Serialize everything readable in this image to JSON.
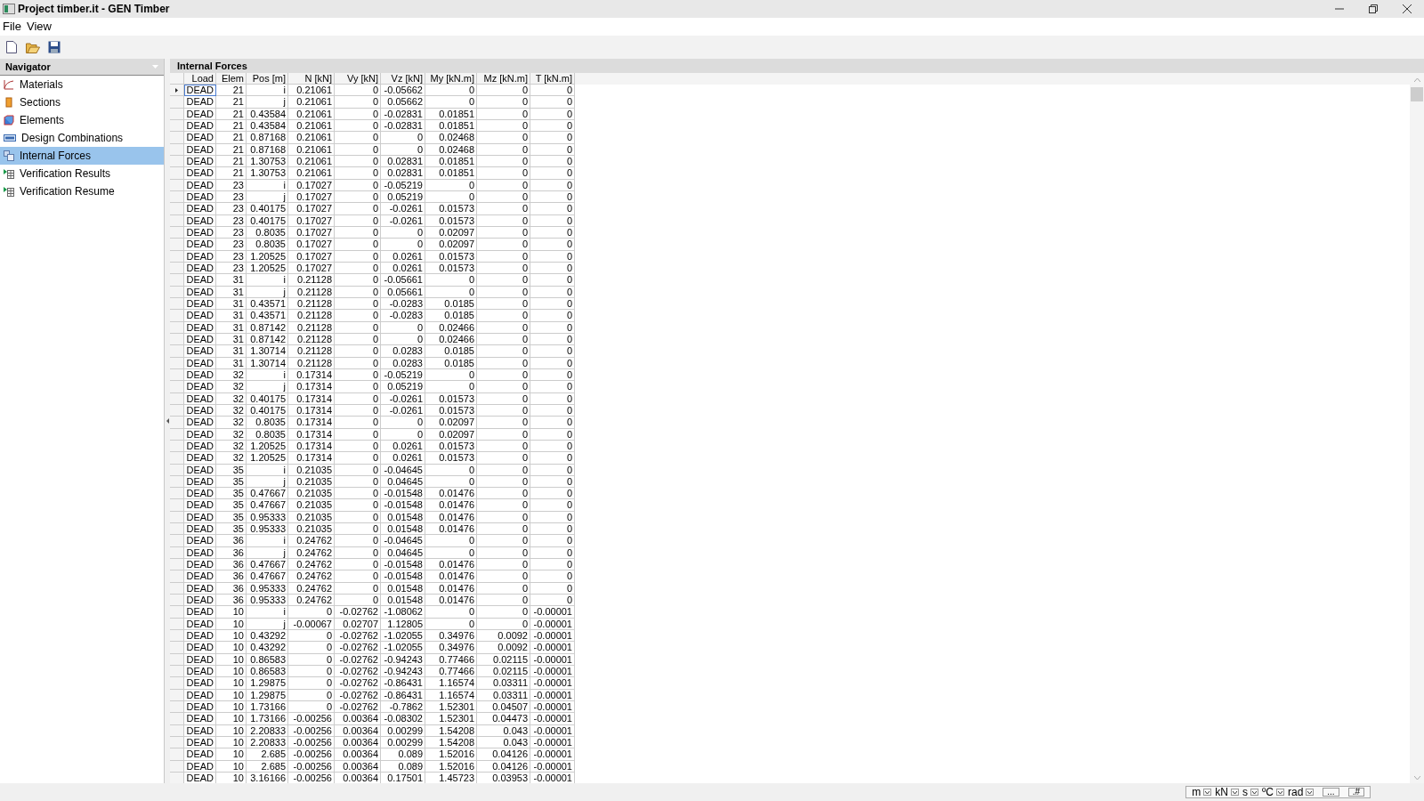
{
  "window": {
    "title": "Project timber.it - GEN Timber"
  },
  "menu": [
    "File",
    "View"
  ],
  "navigator": {
    "title": "Navigator",
    "items": [
      {
        "label": "Materials",
        "kind": "materials",
        "selected": false
      },
      {
        "label": "Sections",
        "kind": "sections",
        "selected": false
      },
      {
        "label": "Elements",
        "kind": "elements",
        "selected": false
      },
      {
        "label": "Design Combinations",
        "kind": "combinations",
        "selected": false
      },
      {
        "label": "Internal Forces",
        "kind": "forces",
        "selected": true
      },
      {
        "label": "Verification Results",
        "kind": "results",
        "selected": false
      },
      {
        "label": "Verification Resume",
        "kind": "results",
        "selected": false
      }
    ]
  },
  "panel": {
    "title": "Internal Forces"
  },
  "table": {
    "columns": [
      "Load",
      "Elem",
      "Pos [m]",
      "N [kN]",
      "Vy [kN]",
      "Vz [kN]",
      "My [kN.m]",
      "Mz [kN.m]",
      "T [kN.m]"
    ],
    "rows": [
      {
        "selected": true,
        "cells": [
          "DEAD",
          "21",
          "i",
          "0.21061",
          "0",
          "-0.05662",
          "0",
          "0",
          "0"
        ]
      },
      {
        "selected": false,
        "cells": [
          "DEAD",
          "21",
          "j",
          "0.21061",
          "0",
          "0.05662",
          "0",
          "0",
          "0"
        ]
      },
      {
        "selected": false,
        "cells": [
          "DEAD",
          "21",
          "0.43584",
          "0.21061",
          "0",
          "-0.02831",
          "0.01851",
          "0",
          "0"
        ]
      },
      {
        "selected": false,
        "cells": [
          "DEAD",
          "21",
          "0.43584",
          "0.21061",
          "0",
          "-0.02831",
          "0.01851",
          "0",
          "0"
        ]
      },
      {
        "selected": false,
        "cells": [
          "DEAD",
          "21",
          "0.87168",
          "0.21061",
          "0",
          "0",
          "0.02468",
          "0",
          "0"
        ]
      },
      {
        "selected": false,
        "cells": [
          "DEAD",
          "21",
          "0.87168",
          "0.21061",
          "0",
          "0",
          "0.02468",
          "0",
          "0"
        ]
      },
      {
        "selected": false,
        "cells": [
          "DEAD",
          "21",
          "1.30753",
          "0.21061",
          "0",
          "0.02831",
          "0.01851",
          "0",
          "0"
        ]
      },
      {
        "selected": false,
        "cells": [
          "DEAD",
          "21",
          "1.30753",
          "0.21061",
          "0",
          "0.02831",
          "0.01851",
          "0",
          "0"
        ]
      },
      {
        "selected": false,
        "cells": [
          "DEAD",
          "23",
          "i",
          "0.17027",
          "0",
          "-0.05219",
          "0",
          "0",
          "0"
        ]
      },
      {
        "selected": false,
        "cells": [
          "DEAD",
          "23",
          "j",
          "0.17027",
          "0",
          "0.05219",
          "0",
          "0",
          "0"
        ]
      },
      {
        "selected": false,
        "cells": [
          "DEAD",
          "23",
          "0.40175",
          "0.17027",
          "0",
          "-0.0261",
          "0.01573",
          "0",
          "0"
        ]
      },
      {
        "selected": false,
        "cells": [
          "DEAD",
          "23",
          "0.40175",
          "0.17027",
          "0",
          "-0.0261",
          "0.01573",
          "0",
          "0"
        ]
      },
      {
        "selected": false,
        "cells": [
          "DEAD",
          "23",
          "0.8035",
          "0.17027",
          "0",
          "0",
          "0.02097",
          "0",
          "0"
        ]
      },
      {
        "selected": false,
        "cells": [
          "DEAD",
          "23",
          "0.8035",
          "0.17027",
          "0",
          "0",
          "0.02097",
          "0",
          "0"
        ]
      },
      {
        "selected": false,
        "cells": [
          "DEAD",
          "23",
          "1.20525",
          "0.17027",
          "0",
          "0.0261",
          "0.01573",
          "0",
          "0"
        ]
      },
      {
        "selected": false,
        "cells": [
          "DEAD",
          "23",
          "1.20525",
          "0.17027",
          "0",
          "0.0261",
          "0.01573",
          "0",
          "0"
        ]
      },
      {
        "selected": false,
        "cells": [
          "DEAD",
          "31",
          "i",
          "0.21128",
          "0",
          "-0.05661",
          "0",
          "0",
          "0"
        ]
      },
      {
        "selected": false,
        "cells": [
          "DEAD",
          "31",
          "j",
          "0.21128",
          "0",
          "0.05661",
          "0",
          "0",
          "0"
        ]
      },
      {
        "selected": false,
        "cells": [
          "DEAD",
          "31",
          "0.43571",
          "0.21128",
          "0",
          "-0.0283",
          "0.0185",
          "0",
          "0"
        ]
      },
      {
        "selected": false,
        "cells": [
          "DEAD",
          "31",
          "0.43571",
          "0.21128",
          "0",
          "-0.0283",
          "0.0185",
          "0",
          "0"
        ]
      },
      {
        "selected": false,
        "cells": [
          "DEAD",
          "31",
          "0.87142",
          "0.21128",
          "0",
          "0",
          "0.02466",
          "0",
          "0"
        ]
      },
      {
        "selected": false,
        "cells": [
          "DEAD",
          "31",
          "0.87142",
          "0.21128",
          "0",
          "0",
          "0.02466",
          "0",
          "0"
        ]
      },
      {
        "selected": false,
        "cells": [
          "DEAD",
          "31",
          "1.30714",
          "0.21128",
          "0",
          "0.0283",
          "0.0185",
          "0",
          "0"
        ]
      },
      {
        "selected": false,
        "cells": [
          "DEAD",
          "31",
          "1.30714",
          "0.21128",
          "0",
          "0.0283",
          "0.0185",
          "0",
          "0"
        ]
      },
      {
        "selected": false,
        "cells": [
          "DEAD",
          "32",
          "i",
          "0.17314",
          "0",
          "-0.05219",
          "0",
          "0",
          "0"
        ]
      },
      {
        "selected": false,
        "cells": [
          "DEAD",
          "32",
          "j",
          "0.17314",
          "0",
          "0.05219",
          "0",
          "0",
          "0"
        ]
      },
      {
        "selected": false,
        "cells": [
          "DEAD",
          "32",
          "0.40175",
          "0.17314",
          "0",
          "-0.0261",
          "0.01573",
          "0",
          "0"
        ]
      },
      {
        "selected": false,
        "cells": [
          "DEAD",
          "32",
          "0.40175",
          "0.17314",
          "0",
          "-0.0261",
          "0.01573",
          "0",
          "0"
        ]
      },
      {
        "selected": false,
        "cells": [
          "DEAD",
          "32",
          "0.8035",
          "0.17314",
          "0",
          "0",
          "0.02097",
          "0",
          "0"
        ]
      },
      {
        "selected": false,
        "cells": [
          "DEAD",
          "32",
          "0.8035",
          "0.17314",
          "0",
          "0",
          "0.02097",
          "0",
          "0"
        ]
      },
      {
        "selected": false,
        "cells": [
          "DEAD",
          "32",
          "1.20525",
          "0.17314",
          "0",
          "0.0261",
          "0.01573",
          "0",
          "0"
        ]
      },
      {
        "selected": false,
        "cells": [
          "DEAD",
          "32",
          "1.20525",
          "0.17314",
          "0",
          "0.0261",
          "0.01573",
          "0",
          "0"
        ]
      },
      {
        "selected": false,
        "cells": [
          "DEAD",
          "35",
          "i",
          "0.21035",
          "0",
          "-0.04645",
          "0",
          "0",
          "0"
        ]
      },
      {
        "selected": false,
        "cells": [
          "DEAD",
          "35",
          "j",
          "0.21035",
          "0",
          "0.04645",
          "0",
          "0",
          "0"
        ]
      },
      {
        "selected": false,
        "cells": [
          "DEAD",
          "35",
          "0.47667",
          "0.21035",
          "0",
          "-0.01548",
          "0.01476",
          "0",
          "0"
        ]
      },
      {
        "selected": false,
        "cells": [
          "DEAD",
          "35",
          "0.47667",
          "0.21035",
          "0",
          "-0.01548",
          "0.01476",
          "0",
          "0"
        ]
      },
      {
        "selected": false,
        "cells": [
          "DEAD",
          "35",
          "0.95333",
          "0.21035",
          "0",
          "0.01548",
          "0.01476",
          "0",
          "0"
        ]
      },
      {
        "selected": false,
        "cells": [
          "DEAD",
          "35",
          "0.95333",
          "0.21035",
          "0",
          "0.01548",
          "0.01476",
          "0",
          "0"
        ]
      },
      {
        "selected": false,
        "cells": [
          "DEAD",
          "36",
          "i",
          "0.24762",
          "0",
          "-0.04645",
          "0",
          "0",
          "0"
        ]
      },
      {
        "selected": false,
        "cells": [
          "DEAD",
          "36",
          "j",
          "0.24762",
          "0",
          "0.04645",
          "0",
          "0",
          "0"
        ]
      },
      {
        "selected": false,
        "cells": [
          "DEAD",
          "36",
          "0.47667",
          "0.24762",
          "0",
          "-0.01548",
          "0.01476",
          "0",
          "0"
        ]
      },
      {
        "selected": false,
        "cells": [
          "DEAD",
          "36",
          "0.47667",
          "0.24762",
          "0",
          "-0.01548",
          "0.01476",
          "0",
          "0"
        ]
      },
      {
        "selected": false,
        "cells": [
          "DEAD",
          "36",
          "0.95333",
          "0.24762",
          "0",
          "0.01548",
          "0.01476",
          "0",
          "0"
        ]
      },
      {
        "selected": false,
        "cells": [
          "DEAD",
          "36",
          "0.95333",
          "0.24762",
          "0",
          "0.01548",
          "0.01476",
          "0",
          "0"
        ]
      },
      {
        "selected": false,
        "cells": [
          "DEAD",
          "10",
          "i",
          "0",
          "-0.02762",
          "-1.08062",
          "0",
          "0",
          "-0.00001"
        ]
      },
      {
        "selected": false,
        "cells": [
          "DEAD",
          "10",
          "j",
          "-0.00067",
          "0.02707",
          "1.12805",
          "0",
          "0",
          "-0.00001"
        ]
      },
      {
        "selected": false,
        "cells": [
          "DEAD",
          "10",
          "0.43292",
          "0",
          "-0.02762",
          "-1.02055",
          "0.34976",
          "0.0092",
          "-0.00001"
        ]
      },
      {
        "selected": false,
        "cells": [
          "DEAD",
          "10",
          "0.43292",
          "0",
          "-0.02762",
          "-1.02055",
          "0.34976",
          "0.0092",
          "-0.00001"
        ]
      },
      {
        "selected": false,
        "cells": [
          "DEAD",
          "10",
          "0.86583",
          "0",
          "-0.02762",
          "-0.94243",
          "0.77466",
          "0.02115",
          "-0.00001"
        ]
      },
      {
        "selected": false,
        "cells": [
          "DEAD",
          "10",
          "0.86583",
          "0",
          "-0.02762",
          "-0.94243",
          "0.77466",
          "0.02115",
          "-0.00001"
        ]
      },
      {
        "selected": false,
        "cells": [
          "DEAD",
          "10",
          "1.29875",
          "0",
          "-0.02762",
          "-0.86431",
          "1.16574",
          "0.03311",
          "-0.00001"
        ]
      },
      {
        "selected": false,
        "cells": [
          "DEAD",
          "10",
          "1.29875",
          "0",
          "-0.02762",
          "-0.86431",
          "1.16574",
          "0.03311",
          "-0.00001"
        ]
      },
      {
        "selected": false,
        "cells": [
          "DEAD",
          "10",
          "1.73166",
          "0",
          "-0.02762",
          "-0.7862",
          "1.52301",
          "0.04507",
          "-0.00001"
        ]
      },
      {
        "selected": false,
        "cells": [
          "DEAD",
          "10",
          "1.73166",
          "-0.00256",
          "0.00364",
          "-0.08302",
          "1.52301",
          "0.04473",
          "-0.00001"
        ]
      },
      {
        "selected": false,
        "cells": [
          "DEAD",
          "10",
          "2.20833",
          "-0.00256",
          "0.00364",
          "0.00299",
          "1.54208",
          "0.043",
          "-0.00001"
        ]
      },
      {
        "selected": false,
        "cells": [
          "DEAD",
          "10",
          "2.20833",
          "-0.00256",
          "0.00364",
          "0.00299",
          "1.54208",
          "0.043",
          "-0.00001"
        ]
      },
      {
        "selected": false,
        "cells": [
          "DEAD",
          "10",
          "2.685",
          "-0.00256",
          "0.00364",
          "0.089",
          "1.52016",
          "0.04126",
          "-0.00001"
        ]
      },
      {
        "selected": false,
        "cells": [
          "DEAD",
          "10",
          "2.685",
          "-0.00256",
          "0.00364",
          "0.089",
          "1.52016",
          "0.04126",
          "-0.00001"
        ]
      },
      {
        "selected": false,
        "cells": [
          "DEAD",
          "10",
          "3.16166",
          "-0.00256",
          "0.00364",
          "0.17501",
          "1.45723",
          "0.03953",
          "-0.00001"
        ]
      }
    ]
  },
  "status_bar": {
    "units": [
      "m",
      "kN",
      "s",
      "ºC",
      "rad"
    ],
    "buttons": [
      "...",
      ".#"
    ]
  }
}
